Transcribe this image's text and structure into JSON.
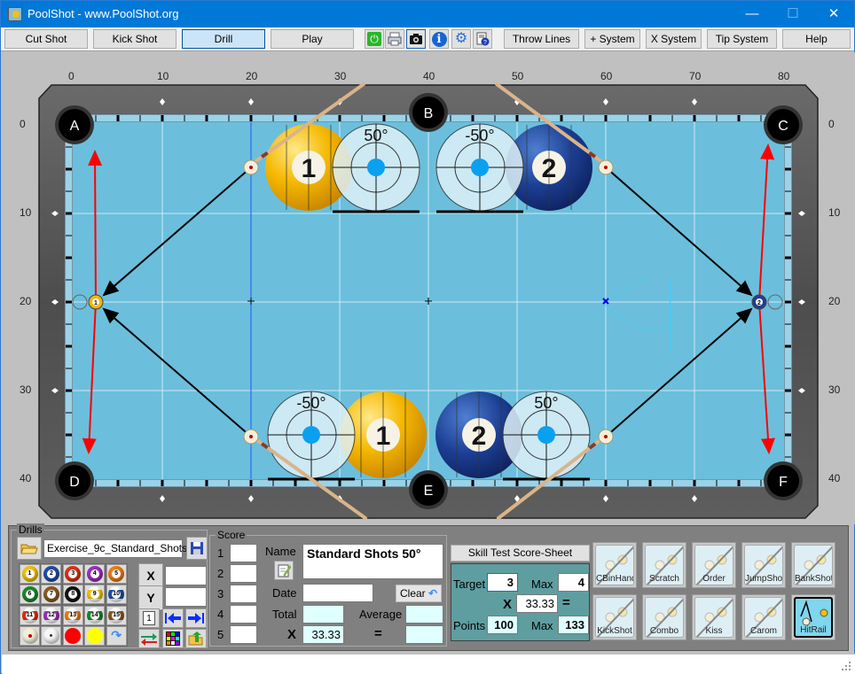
{
  "window": {
    "title": "PoolShot - www.PoolShot.org",
    "controls": {
      "minimize": "—",
      "maximize": "☐",
      "close": "✕"
    }
  },
  "toolbar": {
    "buttons": [
      {
        "label": "Cut Shot",
        "active": false
      },
      {
        "label": "Kick Shot",
        "active": false
      },
      {
        "label": "Drill",
        "active": true
      },
      {
        "label": "Play",
        "active": false
      }
    ],
    "icons": [
      "power-icon",
      "print-icon",
      "camera-icon",
      "info-icon",
      "settings-icon",
      "help-doc-icon"
    ],
    "right_buttons": [
      {
        "label": "Throw Lines"
      },
      {
        "label": "+ System"
      },
      {
        "label": "X System"
      },
      {
        "label": "Tip System"
      },
      {
        "label": "Help"
      }
    ]
  },
  "table": {
    "x_ticks": [
      "0",
      "10",
      "20",
      "30",
      "40",
      "50",
      "60",
      "70",
      "80"
    ],
    "y_ticks": [
      "0",
      "10",
      "20",
      "30",
      "40"
    ],
    "pockets": {
      "A": [
        0,
        0
      ],
      "B": [
        40,
        0
      ],
      "C": [
        80,
        0
      ],
      "D": [
        0,
        40
      ],
      "E": [
        40,
        40
      ],
      "F": [
        80,
        40
      ]
    },
    "pocket_labels": [
      "A",
      "B",
      "C",
      "D",
      "E",
      "F"
    ],
    "cue_balls": [
      [
        20,
        4.8
      ],
      [
        60,
        4.8
      ],
      [
        20,
        35.2
      ],
      [
        60,
        35.2
      ]
    ],
    "object_balls": [
      {
        "num": "1",
        "pos": [
          2.5,
          20
        ],
        "color": "#f2b705"
      },
      {
        "num": "2",
        "pos": [
          77.3,
          20
        ],
        "color": "#1c3f94"
      }
    ],
    "aim_panels": [
      {
        "label": "50°",
        "ball": "1",
        "pos": "top-left"
      },
      {
        "label": "-50°",
        "ball": "2",
        "pos": "top-right"
      },
      {
        "label": "-50°",
        "ball": "1",
        "pos": "bottom-left"
      },
      {
        "label": "50°",
        "ball": "2",
        "pos": "bottom-right"
      }
    ],
    "colors": {
      "felt": "#6bbfdc",
      "rail": "#5a5a5a",
      "shot_line": "#000000",
      "object_path": "#ff0000",
      "grid": "#e8f4f8"
    }
  },
  "drills": {
    "group_label": "Drills",
    "file_name": "Exercise_9c_Standard_Shots",
    "balls": [
      {
        "num": "1",
        "color": "#f2c200"
      },
      {
        "num": "2",
        "color": "#1f4ea8"
      },
      {
        "num": "3",
        "color": "#e03010"
      },
      {
        "num": "4",
        "color": "#9b2fc0"
      },
      {
        "num": "5",
        "color": "#f07a10"
      },
      {
        "num": "6",
        "color": "#1a8a2a"
      },
      {
        "num": "7",
        "color": "#8a5a20"
      },
      {
        "num": "8",
        "color": "#111111"
      },
      {
        "num": "9",
        "color": "#f2c200"
      },
      {
        "num": "10",
        "color": "#1f4ea8"
      },
      {
        "num": "11",
        "color": "#e03010"
      },
      {
        "num": "12",
        "color": "#9b2fc0"
      },
      {
        "num": "13",
        "color": "#f07a10"
      },
      {
        "num": "14",
        "color": "#1a8a2a"
      },
      {
        "num": "15",
        "color": "#8a5a20"
      }
    ],
    "x_label": "X",
    "y_label": "Y",
    "x_value": "",
    "y_value": "",
    "page_icon_label": "1"
  },
  "score": {
    "group_label": "Score",
    "rows": [
      "1",
      "2",
      "3",
      "4",
      "5"
    ],
    "name_label": "Name",
    "name_value": "Standard Shots 50°",
    "date_label": "Date",
    "date_value": "",
    "clear_label": "Clear",
    "total_label": "Total",
    "total_value": "",
    "average_label": "Average",
    "average_value": "",
    "x_symbol": "X",
    "multiplier": "33.33",
    "eq_symbol": "=",
    "result_value": ""
  },
  "skill_test": {
    "button_label": "Skill Test Score-Sheet",
    "target_label": "Target",
    "target_value": "3",
    "max_label": "Max",
    "max_value": "4",
    "x_symbol": "X",
    "multiplier": "33.33",
    "eq_symbol": "=",
    "points_label": "Points",
    "points_value": "100",
    "points_max_label": "Max",
    "points_max_value": "133"
  },
  "shot_types": [
    {
      "label": "CBinHand",
      "selected": false
    },
    {
      "label": "Scratch",
      "selected": false
    },
    {
      "label": "Order",
      "selected": false
    },
    {
      "label": "JumpShot",
      "selected": false
    },
    {
      "label": "BankShot",
      "selected": false
    },
    {
      "label": "KickShot",
      "selected": false
    },
    {
      "label": "Combo",
      "selected": false
    },
    {
      "label": "Kiss",
      "selected": false
    },
    {
      "label": "Carom",
      "selected": false
    },
    {
      "label": "HitRail",
      "selected": true
    }
  ]
}
